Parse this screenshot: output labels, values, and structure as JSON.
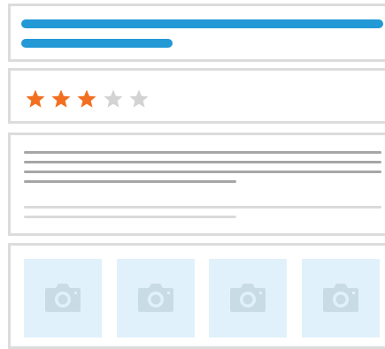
{
  "colors": {
    "accent": "#2399d6",
    "star_filled": "#f26f21",
    "star_empty": "#d3d3d3",
    "text_line_dark": "#a6a6a6",
    "text_line_light": "#dadada",
    "thumb_bg": "#e1f1fb",
    "camera_icon": "#c9dce6",
    "card_border": "#dcdcdc"
  },
  "rating": {
    "value": 3,
    "max": 5
  },
  "gallery": {
    "icons": [
      "camera-icon",
      "camera-icon",
      "camera-icon",
      "camera-icon"
    ]
  }
}
